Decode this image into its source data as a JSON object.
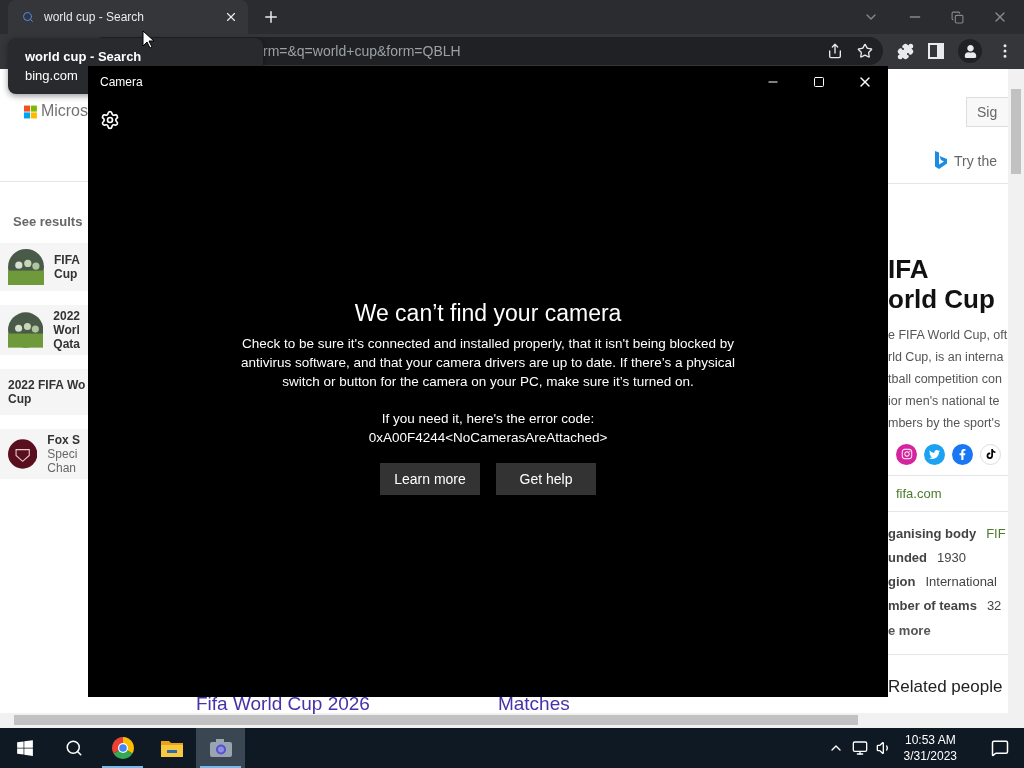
{
  "browser": {
    "tab": {
      "title": "world cup - Search"
    },
    "tooltip": {
      "title": "world cup - Search",
      "domain": "bing.com"
    },
    "address": "rm=&q=world+cup&form=QBLH"
  },
  "page": {
    "left": {
      "logo_text": "Micros",
      "see_results": "See results",
      "results": [
        {
          "lines": [
            "FIFA",
            "Cup"
          ]
        },
        {
          "lines": [
            "2022",
            "Worl",
            "Qata"
          ]
        },
        {
          "kind": "text",
          "lines": [
            "2022 FIFA Wo",
            "Cup"
          ]
        },
        {
          "kind": "logo",
          "lines": [
            "Fox S",
            "Speci",
            "Chan"
          ]
        }
      ]
    },
    "right": {
      "sign_in": "Sig",
      "try_text": "Try the",
      "title_lines": [
        "IFA",
        "orld Cup"
      ],
      "description": [
        "e FIFA World Cup, oft",
        "rld Cup, is an interna",
        "tball competition con",
        "ior men's national te",
        "mbers by the sport's"
      ],
      "site": "fifa.com",
      "facts": [
        {
          "key": "ganising body",
          "value": "FIF",
          "link": true
        },
        {
          "key": "unded",
          "value": "1930",
          "link": false
        },
        {
          "key": "gion",
          "value": "International",
          "link": false
        },
        {
          "key": "mber of teams",
          "value": "32",
          "link": false
        }
      ],
      "see_more": "e more",
      "related": "Related people"
    },
    "bottom_links": [
      "Fifa World Cup 2026",
      "Matches"
    ]
  },
  "camera": {
    "title": "Camera",
    "heading": "We can’t find your camera",
    "body": "Check to be sure it's connected and installed properly, that it isn't being blocked by antivirus software, and that your camera drivers are up to date. If there’s a physical switch or button for the camera on your PC, make sure it’s turned on.",
    "error_label": "If you need it, here's the error code:",
    "error_code": "0xA00F4244<NoCamerasAreAttached>",
    "buttons": [
      "Learn more",
      "Get help"
    ]
  },
  "taskbar": {
    "apps": [
      {
        "kind": "chrome",
        "selected": false
      },
      {
        "kind": "explorer",
        "selected": false
      },
      {
        "kind": "camera",
        "selected": true
      }
    ],
    "time": "10:53 AM",
    "date": "3/31/2023"
  }
}
